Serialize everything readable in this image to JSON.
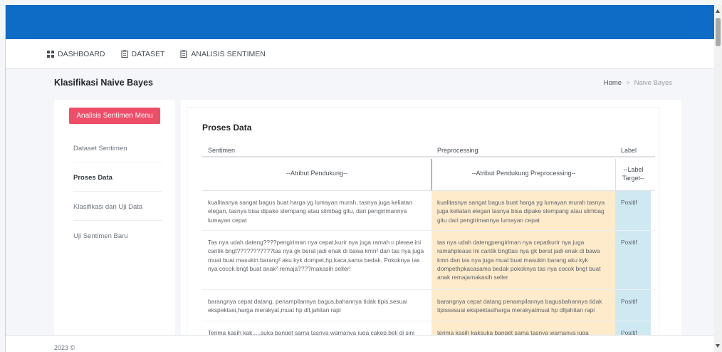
{
  "nav": {
    "items": [
      {
        "label": "DASHBOARD",
        "icon": "grid-icon"
      },
      {
        "label": "DATASET",
        "icon": "clipboard-icon"
      },
      {
        "label": "ANALISIS SENTIMEN",
        "icon": "clipboard-icon"
      }
    ]
  },
  "page": {
    "title": "Klasifikasi Naive Bayes",
    "breadcrumb": {
      "home": "Home",
      "separator": ">",
      "current": "Naive Bayes"
    }
  },
  "sidebar": {
    "menu_button": "Analisis Sentimen Menu",
    "items": [
      "Dataset Sentimen",
      "Proses Data",
      "Klasifikasi dan Uji Data",
      "Uji Sentimen Baru"
    ],
    "active": "Proses Data"
  },
  "card": {
    "title": "Proses Data",
    "table": {
      "headers": [
        "Sentimen",
        "Preprocessing",
        "Label"
      ],
      "subheaders": [
        "--Atribut Pendukung--",
        "--Atribut Pendukung Preprocessing--",
        "--Label Target--"
      ],
      "rows": [
        {
          "sentimen": "kualitasnya sangat bagus buat harga yg lumayan murah, tasnya juga keliatan elegan, tasnya bisa dipake slempang atau slimbag gitu, dari pengirimannya lumayan cepat",
          "preprocessing": "kualitasnya sangat bagus buat harga yg lumayan murah tasnya juga keliatan elegan tasnya bisa dipake slempang atau slimbag gitu dari pengirimannya lumayan cepat",
          "label": "Positif"
        },
        {
          "sentimen": "Tas nya udah dateng????pengiriman nya cepat,kurir nya juga ramah☺please ini cantik bngt???????????tas nya gk berat jadi enak di bawa kmn² dan tas nya juga muat buat masukin barang² aku kyk dompet,hp,kaca,sama bedak. Pokoknya tas nya cocok bngt buat anak² remaja????makasih seller!",
          "preprocessing": "tas nya udah datengpengiriman nya cepatkurir nya juga ramahplease ini cantik bngttas nya gk berat jadi enak di bawa kmn dan tas nya juga muat buat masukin barang aku kyk dompethpkacasama bedak pokoknya tas nya cocok bngt buat anak remajamakasih seller",
          "label": "Positif"
        },
        {
          "sentimen": "barangnya cepat datang, penampilannya bagus,bahannya tidak tipis,sesuai ekspektasi,harga merakyat,muat hp dll,jahitan rapi",
          "preprocessing": "barangnya cepat datang penampilannya bagusbahannya tidak tipissesuai ekspektasiharga merakyatmuat hp dlljahitan rapi",
          "label": "Positif"
        },
        {
          "sentimen": "Terima kasih kak.....suka banget sama tasnya warnanya juga cakep,beli di sini",
          "preprocessing": "terima kasih kaksuka banget sama tasnya warnanya juga",
          "label": "Positif"
        }
      ]
    }
  },
  "footer": {
    "text": "2023 ©"
  },
  "colors": {
    "topbar": "#0f6cc6",
    "accent_button": "#ee4e68",
    "preprocessing_bg": "#fdebcc",
    "label_bg": "#cfe9f3"
  }
}
